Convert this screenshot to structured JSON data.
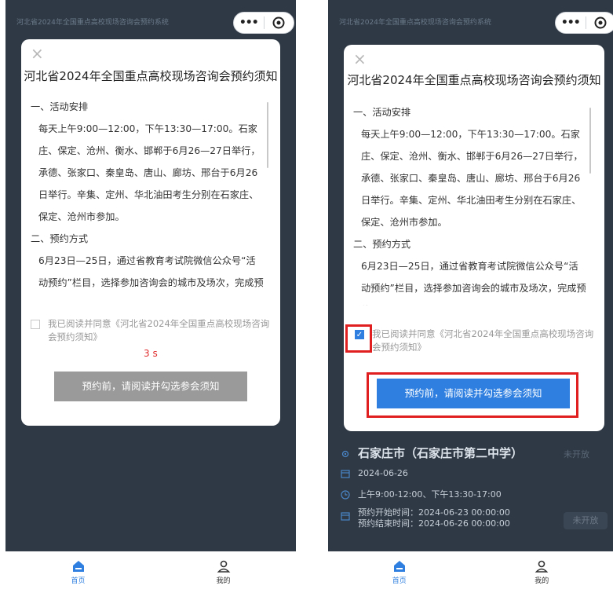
{
  "app": {
    "nav_title": "河北省2024年全国重点高校现场咨询会预约系统"
  },
  "capsule": {
    "more_label": "•••"
  },
  "modal": {
    "close_label": "×",
    "title": "河北省2024年全国重点高校现场咨询会预约须知",
    "content": [
      {
        "kind": "section",
        "text": "一、活动安排"
      },
      {
        "kind": "paragraph",
        "lines": [
          "每天上午9:00—12:00，下午13:30—17:00。石家",
          "庄、保定、沧州、衡水、邯郸于6月26—27日举行，",
          "承德、张家口、秦皇岛、唐山、廊坊、邢台于6月26",
          "日举行。辛集、定州、华北油田考生分别在石家庄、",
          "保定、沧州市参加。"
        ]
      },
      {
        "kind": "section",
        "text": "二、预约方式"
      },
      {
        "kind": "paragraph",
        "lines": [
          "6月23日—25日，通过省教育考试院微信公众号“活",
          "动预约”栏目，选择参加咨询会的城市及场次，完成预约"
        ]
      }
    ],
    "agree_text": "我已阅读并同意《河北省2024年全国重点高校现场咨询会预约须知》",
    "countdown": "3 s",
    "button_label": "预约前，请阅读并勾选参会须知"
  },
  "left_state": {
    "checkbox_checked": false,
    "button_color": "#9a9a9a"
  },
  "right_state": {
    "checkbox_checked": true,
    "button_color": "#2e7fe0",
    "check_mark": "✓"
  },
  "background_card": {
    "venue": "石家庄市（石家庄市第二中学）",
    "status": "未开放",
    "date": "2024-06-26",
    "time": "上午9:00-12:00、下午13:30-17:00",
    "booking_start": "预约开始时间：2024-06-23 00:00:00",
    "booking_end": "预约结束时间：2024-06-26 00:00:00",
    "status_button": "未开放"
  },
  "tabbar": {
    "home_label": "首页",
    "mine_label": "我的"
  },
  "colors": {
    "accent": "#2e7fe0",
    "highlight": "#e02020",
    "countdown": "#e03030",
    "overlay_bg": "#2f3945"
  },
  "icons": {
    "home": "home-icon",
    "user": "user-icon",
    "close": "close-icon",
    "more": "more-dots-icon",
    "target": "target-icon",
    "location": "location-icon",
    "calendar": "calendar-icon",
    "clock": "clock-icon"
  }
}
